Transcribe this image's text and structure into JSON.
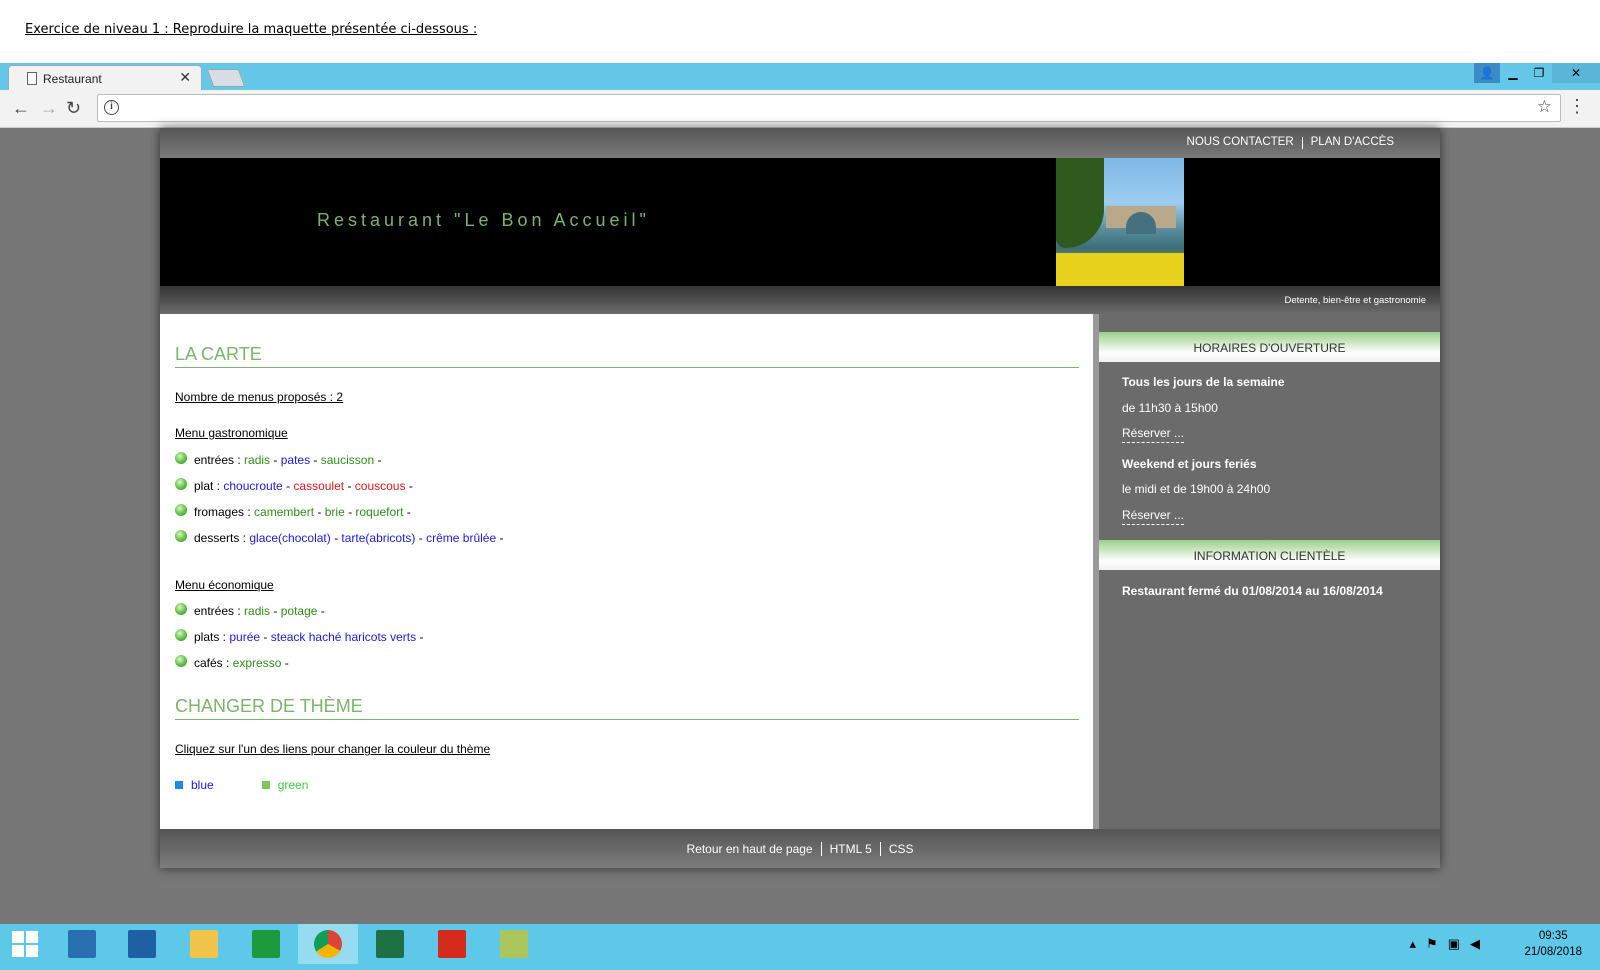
{
  "caption": "Exercice de niveau 1 : Reproduire la maquette présentée ci-dessous :",
  "browser": {
    "tab_title": "Restaurant",
    "tab_close": "✕",
    "omnibox_value": ""
  },
  "site": {
    "topnav": {
      "contact": "NOUS CONTACTER",
      "plan": "PLAN D'ACCÈS"
    },
    "banner_title": "Restaurant \"Le Bon Accueil\"",
    "tagline": "Detente, bien-être et gastronomie",
    "main": {
      "section1_title": "LA CARTE",
      "menus_count": "Nombre de menus proposés : 2",
      "menu1": {
        "title": "Menu gastronomique",
        "rows": [
          {
            "label": "entrées : ",
            "items": [
              {
                "t": "radis",
                "c": "green"
              },
              {
                "t": "pates",
                "c": "blue"
              },
              {
                "t": "saucisson",
                "c": "green"
              }
            ]
          },
          {
            "label": "plat : ",
            "items": [
              {
                "t": "choucroute",
                "c": "blue"
              },
              {
                "t": "cassoulet",
                "c": "red"
              },
              {
                "t": "couscous",
                "c": "red"
              }
            ]
          },
          {
            "label": "fromages : ",
            "items": [
              {
                "t": "camembert",
                "c": "green"
              },
              {
                "t": "brie",
                "c": "green"
              },
              {
                "t": "roquefort",
                "c": "green"
              }
            ]
          },
          {
            "label": "desserts : ",
            "items": [
              {
                "t": "glace(chocolat)",
                "c": "blue"
              },
              {
                "t": "tarte(abricots)",
                "c": "blue"
              },
              {
                "t": "crême brûlée",
                "c": "blue"
              }
            ]
          }
        ]
      },
      "menu2": {
        "title": "Menu économique",
        "rows": [
          {
            "label": "entrées : ",
            "items": [
              {
                "t": "radis",
                "c": "green"
              },
              {
                "t": "potage",
                "c": "green"
              }
            ]
          },
          {
            "label": "plats : ",
            "items": [
              {
                "t": "purée",
                "c": "blue"
              },
              {
                "t": "steack haché haricots verts",
                "c": "blue"
              }
            ]
          },
          {
            "label": "cafés : ",
            "items": [
              {
                "t": "expresso",
                "c": "green"
              }
            ]
          }
        ]
      },
      "section2_title": "CHANGER DE THÈME",
      "theme_hint": "Cliquez sur l'un des liens pour changer la couleur du thème",
      "themes": [
        {
          "label": "blue",
          "color": "#1e88e5"
        },
        {
          "label": "green",
          "color": "#7cc85a"
        }
      ]
    },
    "aside": {
      "hours_title": "HORAIRES D'OUVERTURE",
      "week_title": "Tous les jours de la semaine",
      "week_hours": "de 11h30 à 15h00",
      "reserve1": "Réserver ...",
      "weekend_title": "Weekend et jours feriés",
      "weekend_hours": "le midi et de 19h00 à 24h00",
      "reserve2": "Réserver ...",
      "info_title": "INFORMATION CLIENTÈLE",
      "info_text": "Restaurant fermé du 01/08/2014 au 16/08/2014"
    },
    "footer": {
      "top": "Retour en haut de page",
      "html": "HTML 5",
      "css": "CSS"
    }
  },
  "taskbar": {
    "time": "09:35",
    "date": "21/08/2018"
  },
  "colors": {
    "accent_green": "#79b56a",
    "page_bg": "#777777",
    "taskbar": "#5ec8e8"
  }
}
